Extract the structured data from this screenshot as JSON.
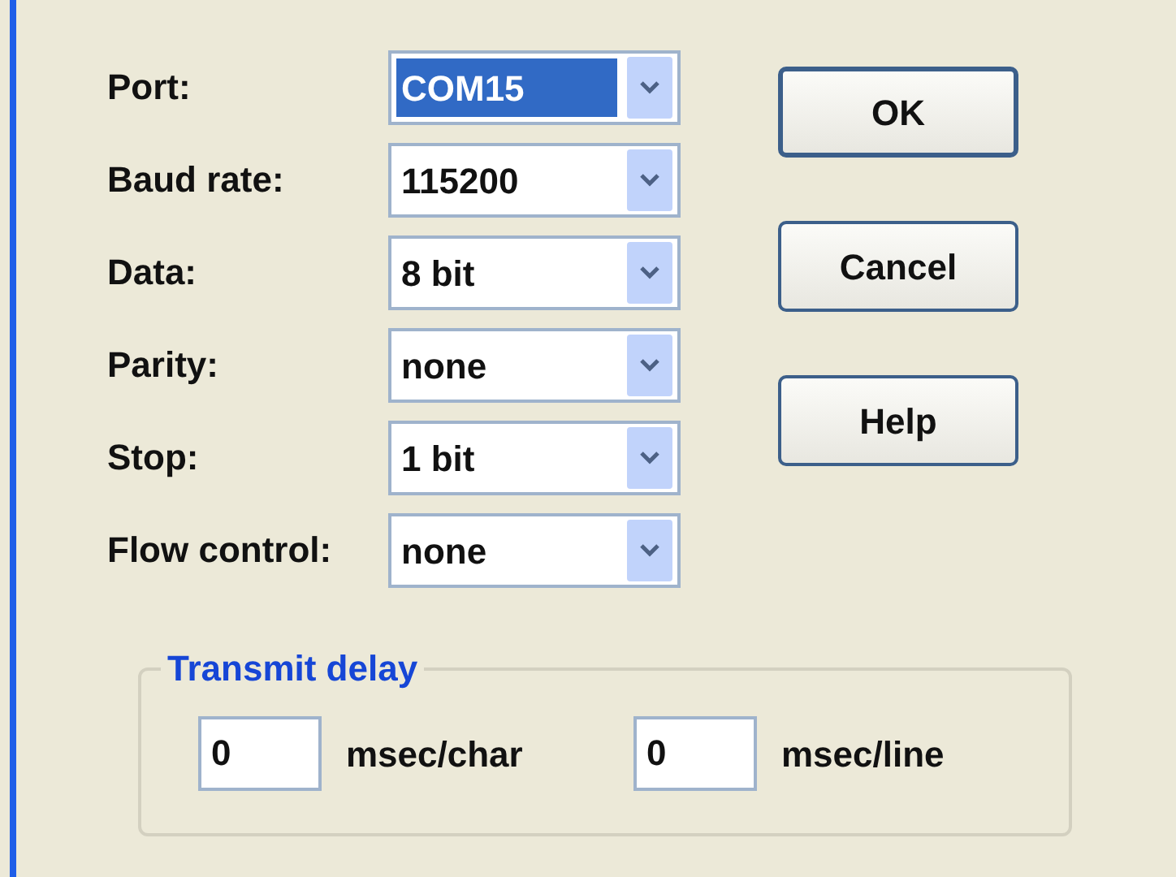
{
  "fields": [
    {
      "label": "Port:",
      "value": "COM15",
      "highlighted": true
    },
    {
      "label": "Baud rate:",
      "value": "115200",
      "highlighted": false
    },
    {
      "label": "Data:",
      "value": "8 bit",
      "highlighted": false
    },
    {
      "label": "Parity:",
      "value": "none",
      "highlighted": false
    },
    {
      "label": "Stop:",
      "value": "1 bit",
      "highlighted": false
    },
    {
      "label": "Flow control:",
      "value": "none",
      "highlighted": false
    }
  ],
  "buttons": [
    {
      "label": "OK",
      "default": true
    },
    {
      "label": "Cancel",
      "default": false
    },
    {
      "label": "Help",
      "default": false
    }
  ],
  "transmit_delay": {
    "title": "Transmit delay",
    "inputs": [
      {
        "value": "0",
        "unit": "msec/char"
      },
      {
        "value": "0",
        "unit": "msec/line"
      }
    ]
  }
}
